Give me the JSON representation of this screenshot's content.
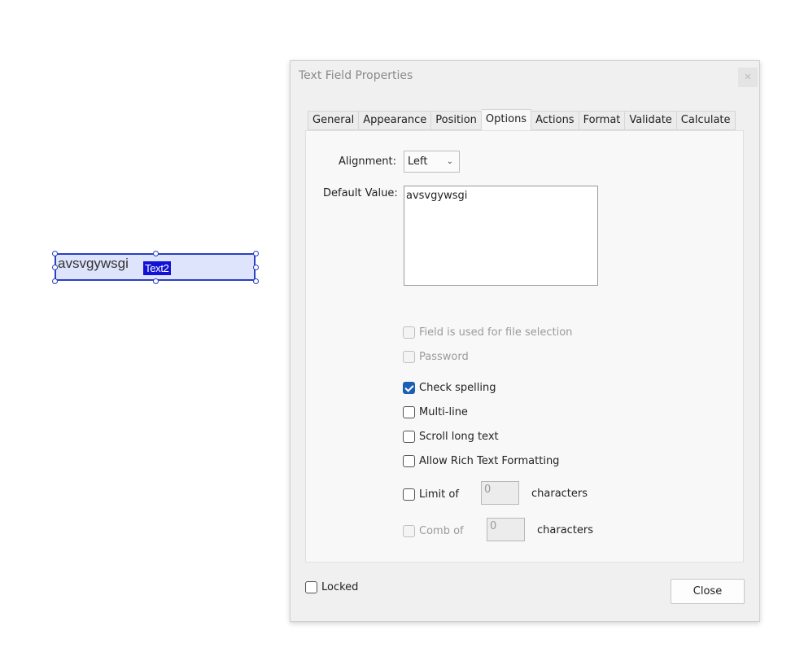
{
  "field": {
    "value": "avsvgywsgi",
    "name_tag": "Text2"
  },
  "dialog": {
    "title": "Text Field Properties",
    "close_icon": "close-icon",
    "tabs": [
      {
        "label": "General"
      },
      {
        "label": "Appearance"
      },
      {
        "label": "Position"
      },
      {
        "label": "Options",
        "active": true
      },
      {
        "label": "Actions"
      },
      {
        "label": "Format"
      },
      {
        "label": "Validate"
      },
      {
        "label": "Calculate"
      }
    ],
    "options": {
      "alignment_label": "Alignment:",
      "alignment_value": "Left",
      "default_value_label": "Default Value:",
      "default_value": "avsvgywsgi",
      "file_selection": {
        "label": "Field is used for file selection",
        "checked": false,
        "enabled": false
      },
      "password": {
        "label": "Password",
        "checked": false,
        "enabled": false
      },
      "check_spelling": {
        "label": "Check spelling",
        "checked": true,
        "enabled": true
      },
      "multi_line": {
        "label": "Multi-line",
        "checked": false,
        "enabled": true
      },
      "scroll_long_text": {
        "label": "Scroll long text",
        "checked": false,
        "enabled": true
      },
      "rich_text": {
        "label": "Allow Rich Text Formatting",
        "checked": false,
        "enabled": true
      },
      "limit_of": {
        "label": "Limit of",
        "value": "0",
        "suffix": "characters",
        "checked": false,
        "enabled": true
      },
      "comb_of": {
        "label": "Comb of",
        "value": "0",
        "suffix": "characters",
        "checked": false,
        "enabled": false
      }
    },
    "locked": {
      "label": "Locked",
      "checked": false
    },
    "close_button": "Close"
  },
  "colors": {
    "accent": "#1a5fb4",
    "field_fill": "#dde4fb",
    "field_border": "#2b3fc4",
    "tag_bg": "#1212d6"
  }
}
